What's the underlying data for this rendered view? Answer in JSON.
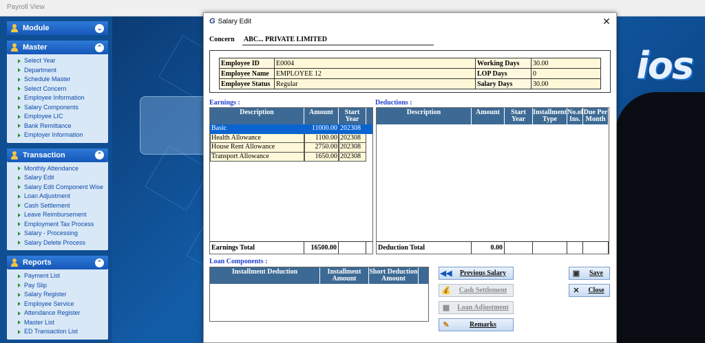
{
  "app": {
    "title": "Payroll View"
  },
  "background": {
    "logo_text": "ios"
  },
  "sidebar": {
    "sections": [
      {
        "title": "Module",
        "chevron": "⌄",
        "items": []
      },
      {
        "title": "Master",
        "chevron": "⌃",
        "items": [
          "Select Year",
          "Department",
          "Schedule Master",
          "Select Concern",
          "Employee Information",
          "Salary Components",
          "Employee LIC",
          "Bank Remittance",
          "Employer Information"
        ]
      },
      {
        "title": "Transaction",
        "chevron": "⌃",
        "items": [
          "Monthly Attendance",
          "Salary Edit",
          "Salary Edit Component Wise",
          "Loan Adjustment",
          "Cash Settlement",
          "Leave Reimbursement",
          "Employment Tax Process",
          "Salary - Processing",
          "Salary Delete Process"
        ]
      },
      {
        "title": "Reports",
        "chevron": "⌃",
        "items": [
          "Payment List",
          "Pay Slip",
          "Salary Register",
          "Employee Service",
          "Attendance Register",
          "Master List",
          "ED Transaction List"
        ]
      }
    ]
  },
  "dialog": {
    "icon_text": "G",
    "title": "Salary Edit",
    "close": "✕",
    "concern_label": "Concern",
    "concern_value": "ABC... PRIVATE LIMITED",
    "employee": {
      "id_label": "Employee ID",
      "id": "E0004",
      "name_label": "Employee Name",
      "name": "EMPLOYEE 12",
      "status_label": "Employee Status",
      "status": "Regular",
      "working_days_label": "Working Days",
      "working_days": "30.00",
      "lop_days_label": "LOP Days",
      "lop_days": "0",
      "salary_days_label": "Salary Days",
      "salary_days": "30.00"
    },
    "earnings": {
      "label": "Earnings :",
      "headers": [
        "Description",
        "Amount",
        "Start Year"
      ],
      "rows": [
        {
          "description": "Basic",
          "amount": "11000.00",
          "start_year": "202308"
        },
        {
          "description": "Health Allowance",
          "amount": "1100.00",
          "start_year": "202308"
        },
        {
          "description": "House Rent Allowance",
          "amount": "2750.00",
          "start_year": "202308"
        },
        {
          "description": "Transport Allowance",
          "amount": "1650.00",
          "start_year": "202308"
        }
      ],
      "total_label": "Earnings Total",
      "total": "16500.00"
    },
    "deductions": {
      "label": "Deductions :",
      "headers": [
        "Description",
        "Amount",
        "Start Year",
        "Installment Type",
        "No.of Ins.",
        "Due Per Month"
      ],
      "total_label": "Deduction Total",
      "total": "0.00"
    },
    "loan": {
      "label": "Loan Components :",
      "headers": [
        "Installment Deduction",
        "Installment Amount",
        "Short Deduction Amount"
      ]
    },
    "buttons": {
      "previous_salary": "Previous Salary",
      "cash_settlement": "Cash Settlement",
      "loan_adjustment": "Loan Adjustment",
      "remarks": "Remarks",
      "save": "Save",
      "close": "Close"
    }
  }
}
